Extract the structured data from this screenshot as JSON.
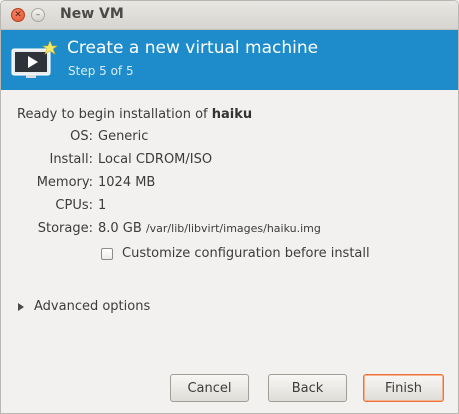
{
  "window": {
    "title": "New VM"
  },
  "titlebar": {
    "close_glyph": "✕",
    "min_glyph": "–"
  },
  "banner": {
    "title": "Create a new virtual machine",
    "step": "Step 5 of 5",
    "icon": "virtual-machine-monitor-icon"
  },
  "summary": {
    "ready_prefix": "Ready to begin installation of ",
    "vm_name": "haiku",
    "rows": [
      {
        "label": "OS:",
        "value": "Generic"
      },
      {
        "label": "Install:",
        "value": "Local CDROM/ISO"
      },
      {
        "label": "Memory:",
        "value": "1024 MB"
      },
      {
        "label": "CPUs:",
        "value": "1"
      },
      {
        "label": "Storage:",
        "value": "8.0 GB",
        "path": "/var/lib/libvirt/images/haiku.img"
      }
    ]
  },
  "customize": {
    "label": "Customize configuration before install",
    "checked": false
  },
  "advanced": {
    "label": "Advanced options",
    "expanded": false
  },
  "buttons": {
    "cancel": "Cancel",
    "back": "Back",
    "finish": "Finish"
  },
  "colors": {
    "banner": "#1e8ccb",
    "accent_focus": "#e8743e",
    "window_bg": "#f2f1f0"
  }
}
